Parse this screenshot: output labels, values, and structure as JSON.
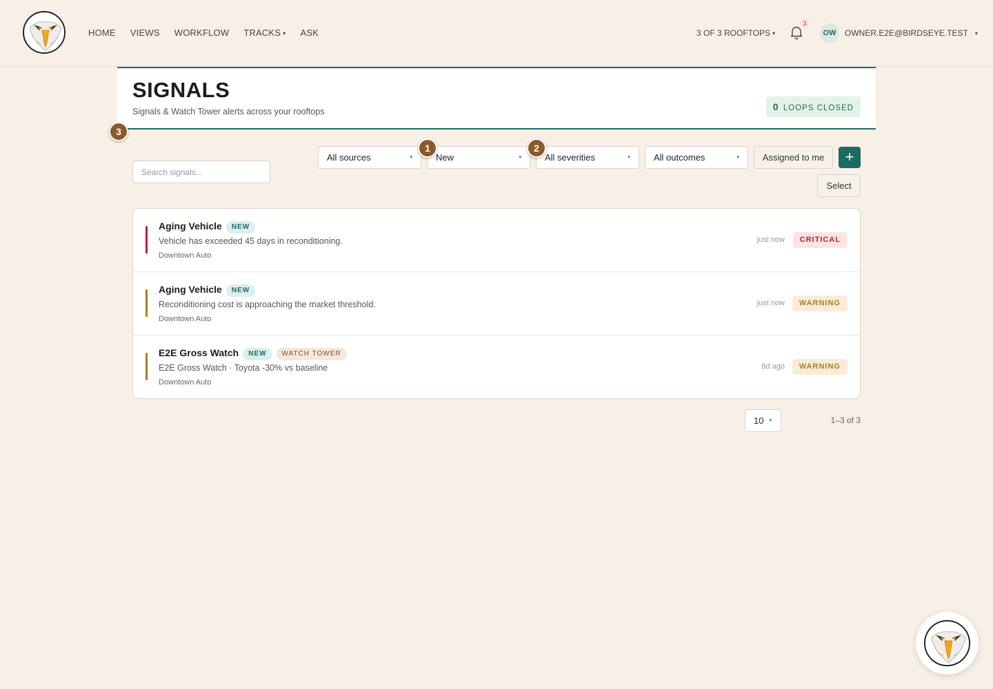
{
  "header": {
    "nav": [
      {
        "label": "HOME"
      },
      {
        "label": "VIEWS"
      },
      {
        "label": "WORKFLOW"
      },
      {
        "label": "TRACKS"
      },
      {
        "label": "ASK"
      }
    ],
    "rooftops_label": "3 OF 3 ROOFTOPS",
    "notification_count": "3",
    "avatar_initials": "OW",
    "user_email": "OWNER.E2E@BIRDSEYE.TEST"
  },
  "page": {
    "title": "SIGNALS",
    "subtitle": "Signals & Watch Tower alerts across your rooftops",
    "loops_count": "0",
    "loops_label": "LOOPS CLOSED"
  },
  "markers": [
    "1",
    "2",
    "3"
  ],
  "filters": {
    "search_placeholder": "Search signals...",
    "sources": "All sources",
    "status": "New",
    "severities": "All severities",
    "outcomes": "All outcomes",
    "assigned_label": "Assigned to me",
    "add_label": "+",
    "select_label": "Select"
  },
  "signals": [
    {
      "title": "Aging Vehicle",
      "status": "NEW",
      "description": "Vehicle has exceeded 45 days in reconditioning.",
      "location": "Downtown Auto",
      "time": "just now",
      "severity": "CRITICAL"
    },
    {
      "title": "Aging Vehicle",
      "status": "NEW",
      "description": "Reconditioning cost is approaching the market threshold.",
      "location": "Downtown Auto",
      "time": "just now",
      "severity": "WARNING"
    },
    {
      "title": "E2E Gross Watch",
      "status": "NEW",
      "tag": "WATCH TOWER",
      "description": "E2E Gross Watch · Toyota -30% vs baseline",
      "location": "Downtown Auto",
      "time": "8d ago",
      "severity": "WARNING"
    }
  ],
  "pagination": {
    "page_size": "10",
    "range": "1–3 of 3"
  },
  "colors": {
    "accent": "#1b6a64",
    "critical": "#c01e35",
    "warning": "#b07a1f",
    "marker": "#8b5a2b",
    "background": "#f8efe6"
  }
}
